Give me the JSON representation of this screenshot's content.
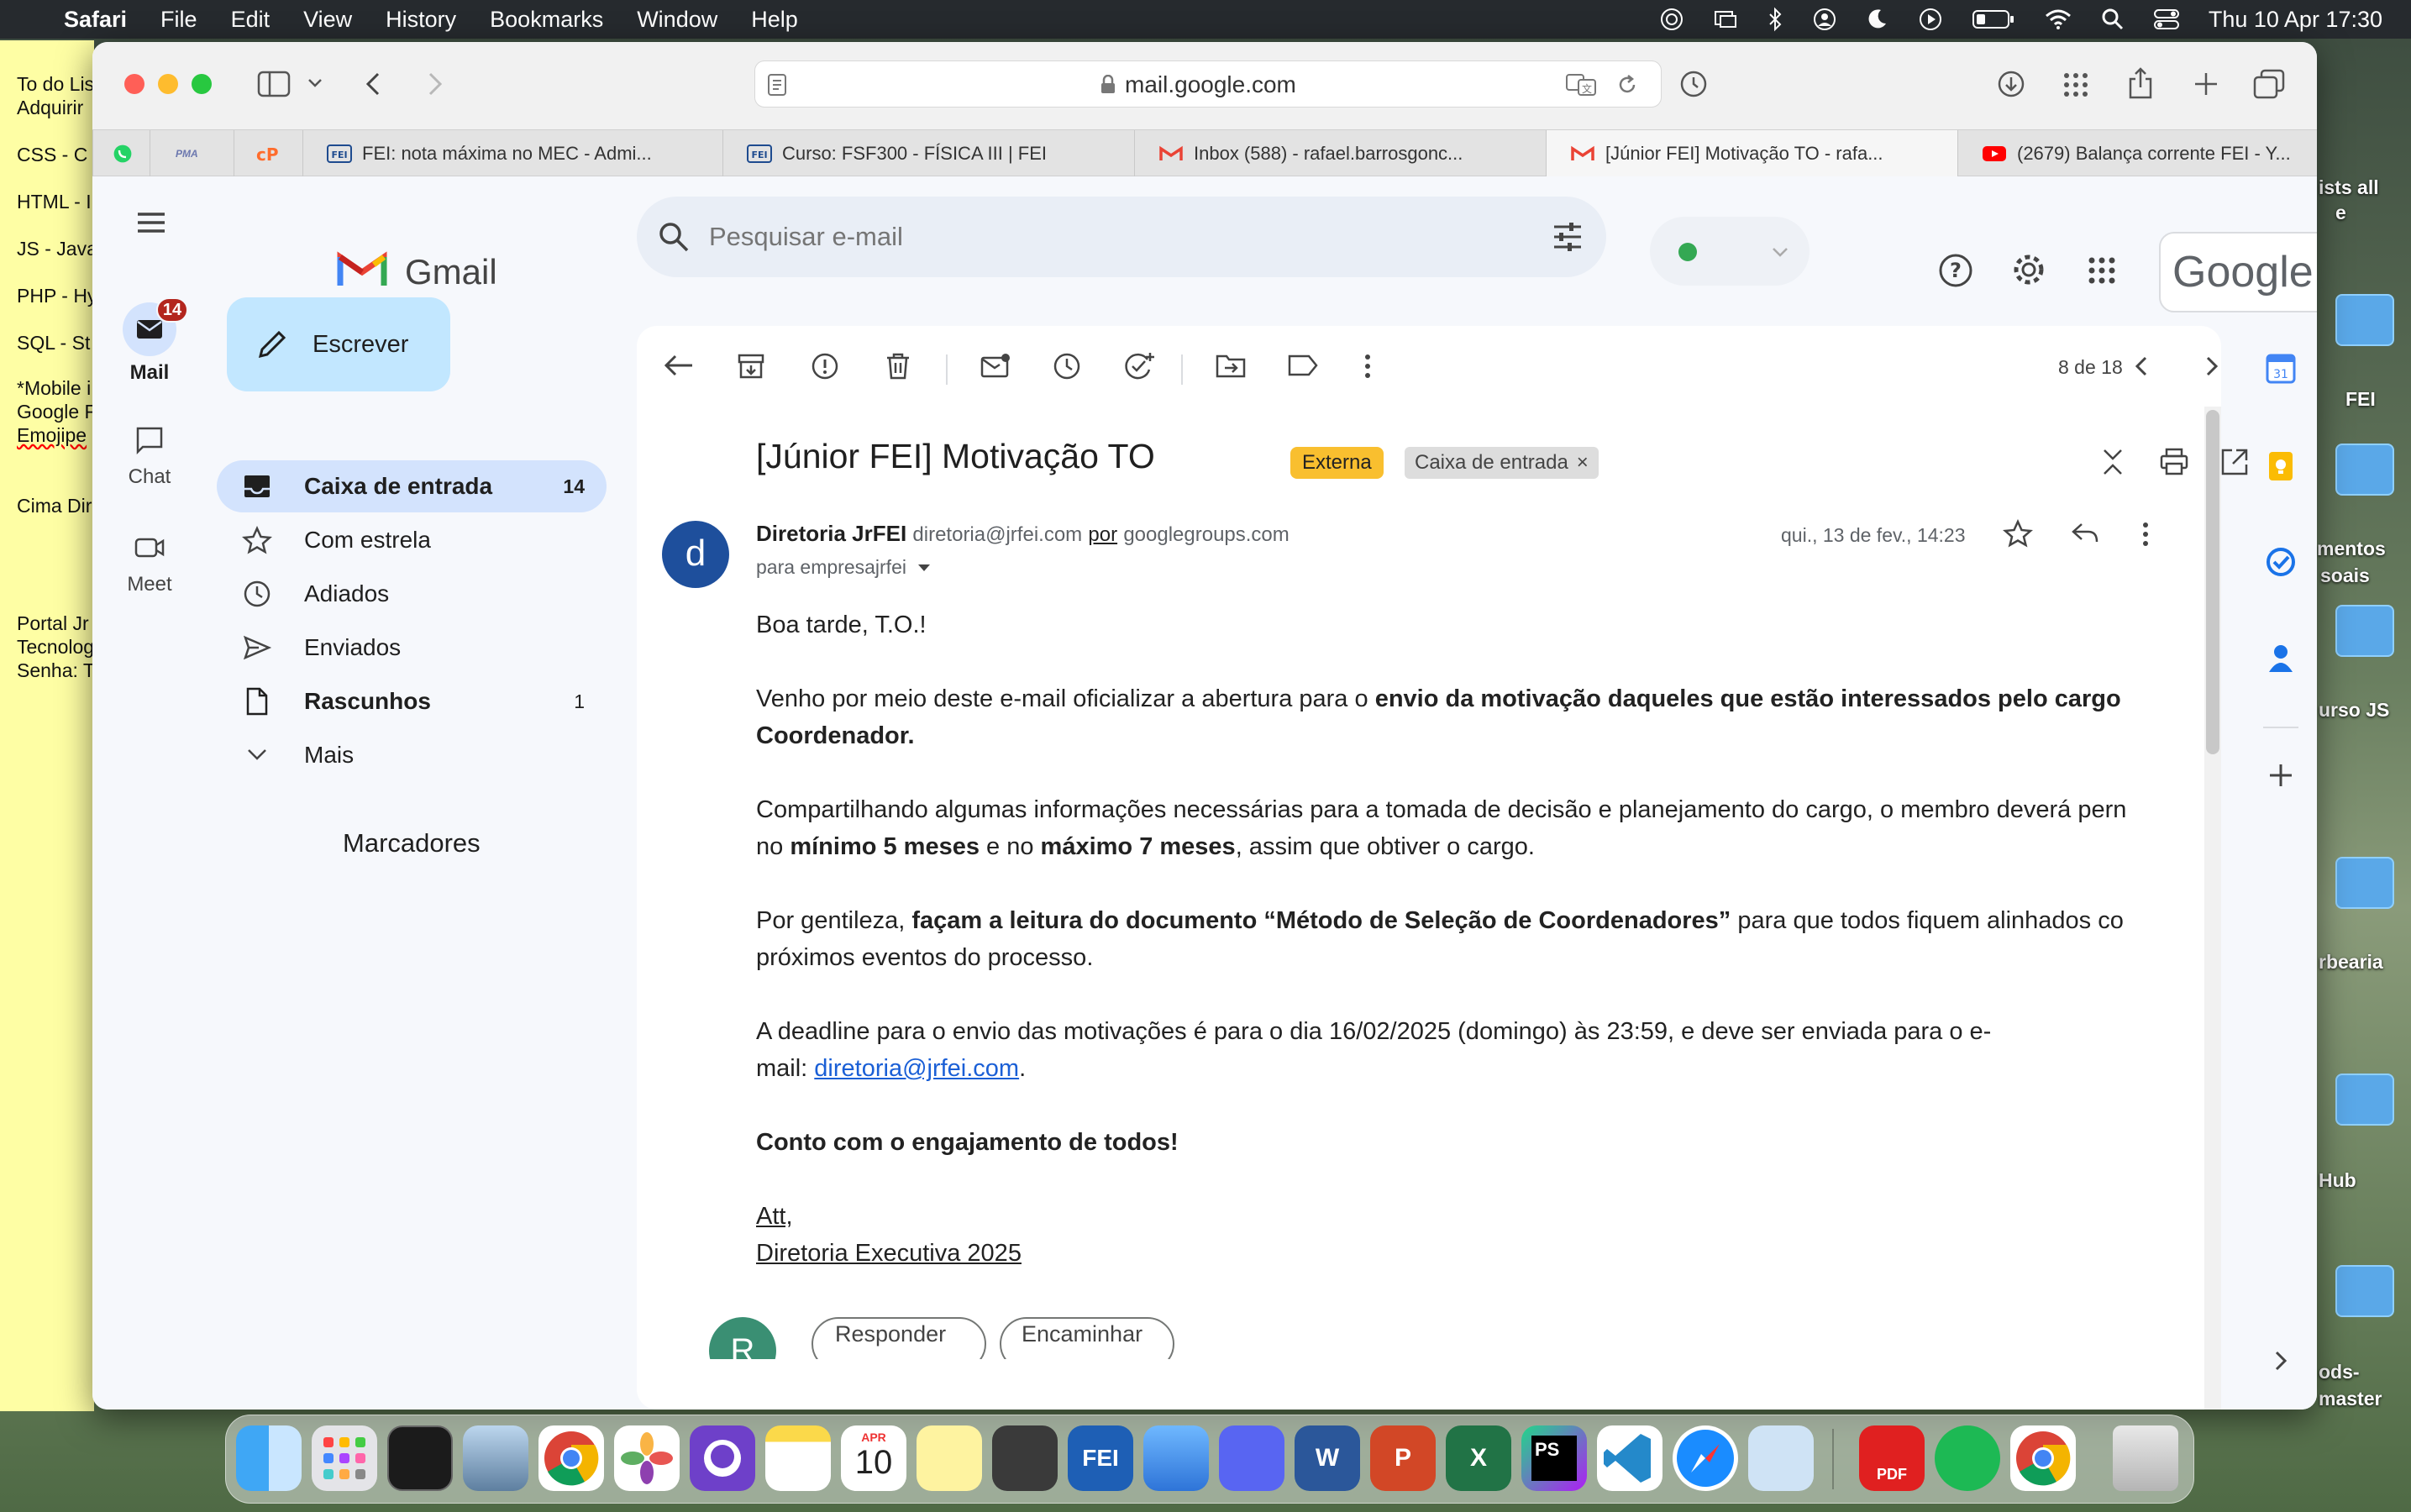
{
  "menubar": {
    "app": "Safari",
    "items": [
      "File",
      "Edit",
      "View",
      "History",
      "Bookmarks",
      "Window",
      "Help"
    ],
    "datetime": "Thu 10 Apr  17:30"
  },
  "desktop": {
    "sticky_lines": [
      "To do Lis",
      "Adquirir",
      "CSS - C",
      "HTML - I",
      "JS - Java",
      "PHP - Hy",
      "SQL - St",
      "*Mobile i",
      "Google F",
      "Emojipe",
      "Cima Dir",
      "Portal Jr",
      "Tecnolog",
      "Senha: T"
    ],
    "icon_labels": [
      "ists all",
      "e",
      "FEI",
      "mentos",
      "soais",
      "urso JS",
      "rbearia",
      "Hub",
      "ods-",
      "master"
    ]
  },
  "browser": {
    "url": "mail.google.com",
    "tabs": [
      {
        "label": "",
        "icon": "whatsapp-icon"
      },
      {
        "label": "PMA",
        "icon": "phpmyadmin-icon"
      },
      {
        "label": "",
        "icon": "cpanel-icon"
      },
      {
        "label": "FEI: nota máxima no MEC - Admi...",
        "icon": "fei-icon"
      },
      {
        "label": "Curso: FSF300 - FÍSICA III | FEI",
        "icon": "fei-icon"
      },
      {
        "label": "Inbox (588) - rafael.barrosgonc...",
        "icon": "gmail-icon"
      },
      {
        "label": "[Júnior FEI] Motivação TO - rafa...",
        "icon": "gmail-icon",
        "active": true
      },
      {
        "label": "(2679) Balança corrente FEI - Y...",
        "icon": "youtube-icon"
      }
    ]
  },
  "gmail": {
    "logo_text": "Gmail",
    "rail": {
      "mail_label": "Mail",
      "mail_badge": "14",
      "chat_label": "Chat",
      "meet_label": "Meet"
    },
    "compose_label": "Escrever",
    "nav": [
      {
        "label": "Caixa de entrada",
        "count": "14",
        "icon": "inbox-icon",
        "active": true
      },
      {
        "label": "Com estrela",
        "count": "",
        "icon": "star-icon"
      },
      {
        "label": "Adiados",
        "count": "",
        "icon": "clock-icon"
      },
      {
        "label": "Enviados",
        "count": "",
        "icon": "send-icon"
      },
      {
        "label": "Rascunhos",
        "count": "1",
        "icon": "draft-icon",
        "bold": true
      },
      {
        "label": "Mais",
        "count": "",
        "icon": "chevron-down-icon"
      }
    ],
    "labels_heading": "Marcadores",
    "search_placeholder": "Pesquisar e-mail",
    "google_text": "Google",
    "avatar_letter": "R",
    "pager": "8 de 18",
    "email": {
      "subject": "[Júnior FEI] Motivação TO",
      "tag_external": "Externa",
      "tag_inbox": "Caixa de entrada",
      "sender_name": "Diretoria JrFEI",
      "sender_email": "diretoria@jrfei.com",
      "via": "por",
      "via_domain": "googlegroups.com",
      "to": "para empresajrfei",
      "date": "qui., 13 de fev., 14:23",
      "avatar_letter": "d",
      "greeting": "Boa tarde, T.O.!",
      "p1_a": "Venho por meio deste e-mail oficializar a abertura para o ",
      "p1_b": "envio da motivação daqueles que estão interessados pelo cargo Coordenador.",
      "p2_a": "Compartilhando algumas informações necessárias para a tomada de decisão e planejamento do cargo, o membro deverá pern",
      "p2_b": "no ",
      "p2_c": "mínimo 5 meses",
      "p2_d": " e no ",
      "p2_e": "máximo 7 meses",
      "p2_f": ", assim que obtiver o cargo.",
      "p3_a": "Por gentileza, ",
      "p3_b": "façam a leitura do documento “Método de Seleção de Coordenadores”",
      "p3_c": " para que todos fiquem alinhados co",
      "p3_d": "próximos eventos do processo.",
      "p4_a": "A deadline para o envio das motivações é para o dia 16/02/2025 (domingo) às 23:59, e deve ser enviada para o e-",
      "p4_b": "mail: ",
      "p4_link": "diretoria@jrfei.com",
      "p4_c": ".",
      "closing": "Conto com o engajamento de todos!",
      "sign1": "Att,",
      "sign2": "Diretoria Executiva 2025",
      "reply_label": "Responder",
      "forward_label": "Encaminhar",
      "reply_avatar": "R"
    }
  },
  "dock": {
    "calendar_month": "APR",
    "calendar_day": "10"
  }
}
